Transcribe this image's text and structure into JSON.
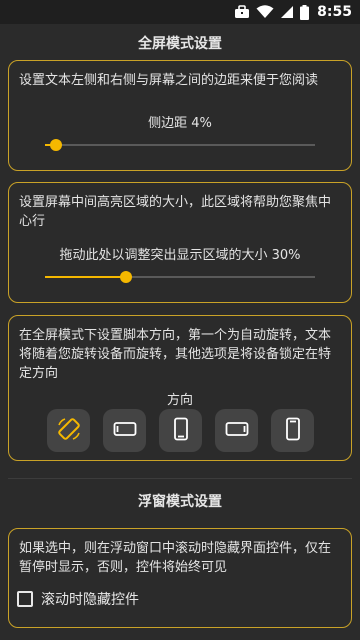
{
  "status_bar": {
    "time": "8:55",
    "icons": [
      "briefcase-icon",
      "wifi-icon",
      "signal-icon",
      "battery-icon"
    ]
  },
  "fullscreen": {
    "title": "全屏模式设置",
    "margin_card": {
      "description": "设置文本左侧和右侧与屏幕之间的边距来便于您阅读",
      "slider_label": "侧边距 4%",
      "slider_value_percent": 4
    },
    "highlight_card": {
      "description": "设置屏幕中间高亮区域的大小，此区域将帮助您聚焦中心行",
      "slider_label": "拖动此处以调整突出显示区域的大小 30%",
      "slider_value_percent": 30
    },
    "orientation_card": {
      "description": "在全屏模式下设置脚本方向，第一个为自动旋转，文本将随着您旋转设备而旋转，其他选项是将设备锁定在特定方向",
      "label": "方向",
      "options": [
        "auto-rotate-icon",
        "landscape-left-icon",
        "portrait-icon",
        "landscape-right-icon",
        "portrait-reverse-icon"
      ],
      "selected_index": 0
    }
  },
  "floating": {
    "title": "浮窗模式设置",
    "hide_card": {
      "description": "如果选中，则在浮动窗口中滚动时隐藏界面控件，仅在暂停时显示，否则，控件将始终可见",
      "checkbox_label": "滚动时隐藏控件",
      "checked": false
    }
  },
  "colors": {
    "accent": "#f5b800",
    "card_border": "#c9a227",
    "background": "#2b2b2b"
  }
}
